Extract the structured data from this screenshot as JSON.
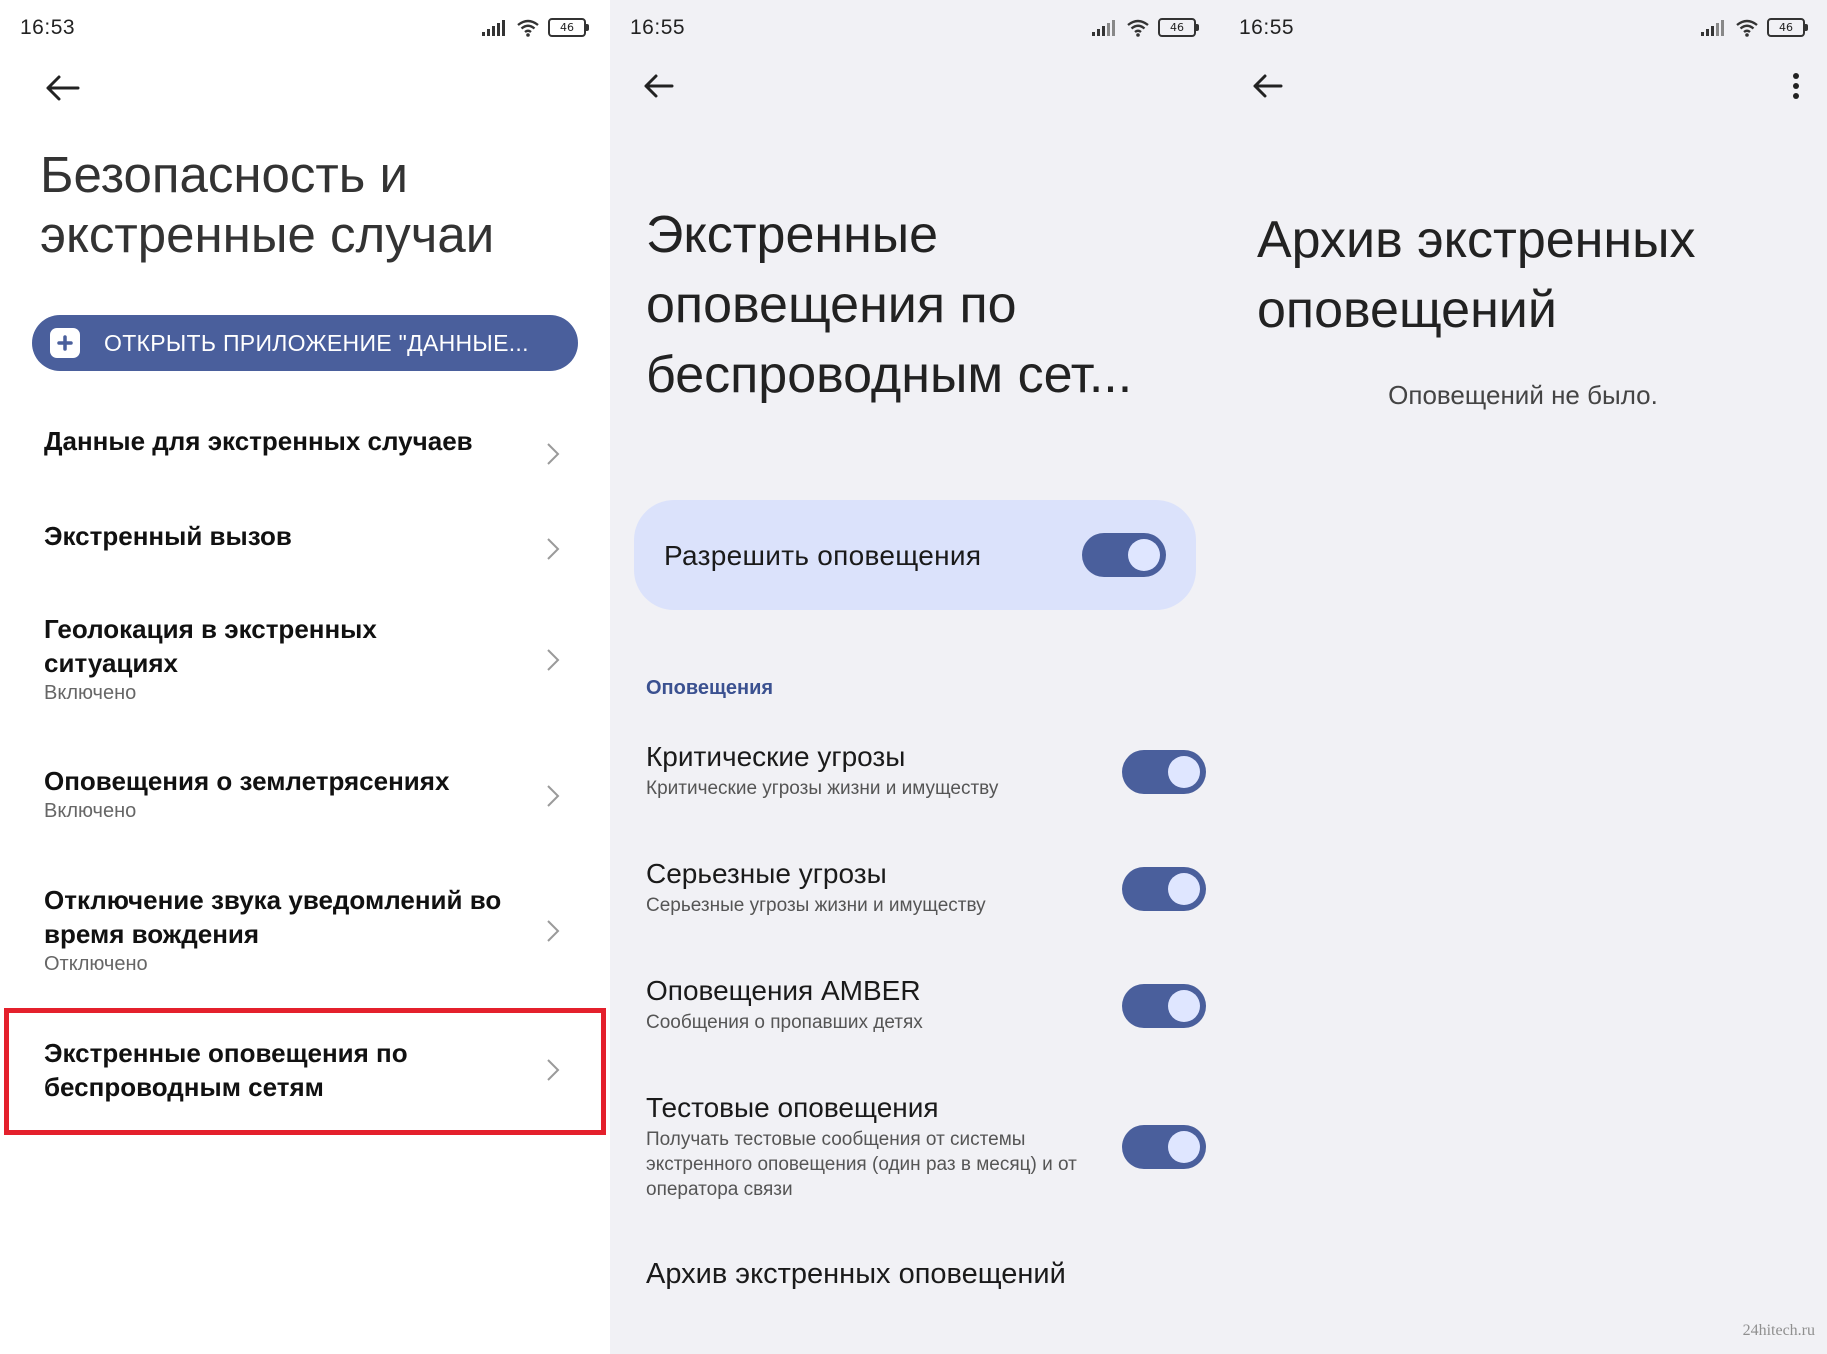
{
  "panel1": {
    "time": "16:53",
    "battery": "46",
    "title": "Безопасность и экстренные случаи",
    "open_app_button": "ОТКРЫТЬ ПРИЛОЖЕНИЕ \"ДАННЫЕ...",
    "items": [
      {
        "title": "Данные для экстренных случаев",
        "subtitle": ""
      },
      {
        "title": "Экстренный вызов",
        "subtitle": ""
      },
      {
        "title": "Геолокация в экстренных ситуациях",
        "subtitle": "Включено"
      },
      {
        "title": "Оповещения о землетрясениях",
        "subtitle": "Включено"
      },
      {
        "title": "Отключение звука уведомлений во время вождения",
        "subtitle": "Отключено"
      },
      {
        "title": "Экстренные оповещения по беспроводным сетям",
        "subtitle": ""
      }
    ]
  },
  "panel2": {
    "time": "16:55",
    "battery": "46",
    "title": "Экстренные оповещения по беспроводным сет...",
    "allow_label": "Разрешить оповещения",
    "allow_on": true,
    "section_header": "Оповещения",
    "rows": [
      {
        "title": "Критические угрозы",
        "subtitle": "Критические угрозы жизни и имуществу",
        "on": true
      },
      {
        "title": "Серьезные угрозы",
        "subtitle": "Серьезные угрозы жизни и имуществу",
        "on": true
      },
      {
        "title": "Оповещения AMBER",
        "subtitle": "Сообщения о пропавших детях",
        "on": true
      },
      {
        "title": "Тестовые оповещения",
        "subtitle": "Получать тестовые сообщения от системы экстренного оповещения (один раз в месяц) и от оператора связи",
        "on": true
      }
    ],
    "archive_link": "Архив экстренных оповещений"
  },
  "panel3": {
    "time": "16:55",
    "battery": "46",
    "title": "Архив экстренных оповещений",
    "empty_text": "Оповещений не было."
  },
  "watermark": "24hitech.ru",
  "colors": {
    "accent": "#4a5f9c",
    "card": "#dbe2fb",
    "highlight": "#e4202c",
    "section": "#3b5190"
  }
}
